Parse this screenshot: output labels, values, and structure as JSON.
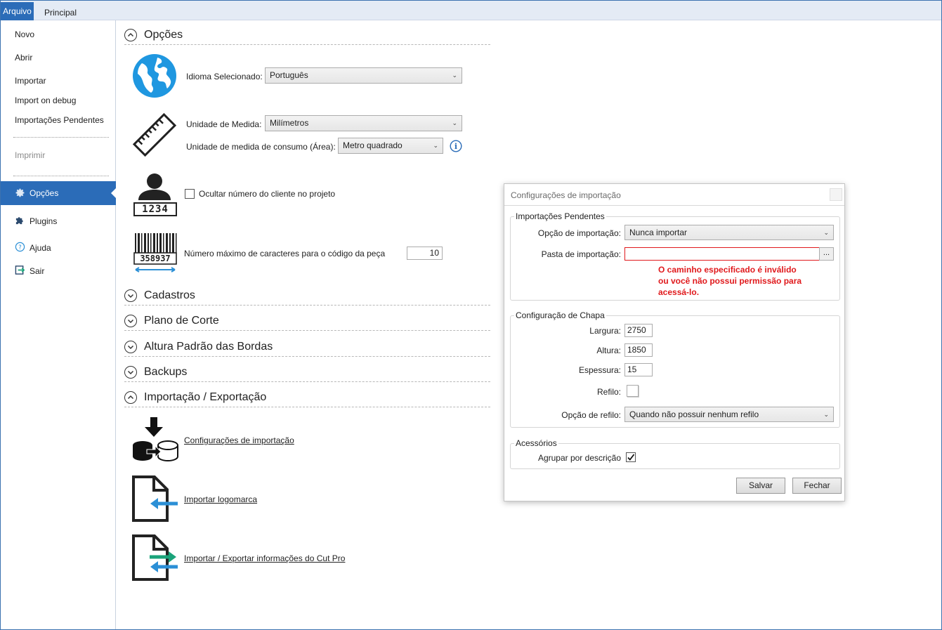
{
  "ribbon": {
    "file_tab": "Arquivo",
    "main_tab": "Principal"
  },
  "sidebar": {
    "novo": "Novo",
    "abrir": "Abrir",
    "importar": "Importar",
    "import_debug": "Import on debug",
    "importacoes_pendentes": "Importações Pendentes",
    "imprimir": "Imprimir",
    "opcoes": "Opções",
    "plugins": "Plugins",
    "ajuda": "Ajuda",
    "sair": "Sair"
  },
  "options": {
    "section_title": "Opções",
    "language_label": "Idioma Selecionado:",
    "language_value": "Português",
    "unit_label": "Unidade de Medida:",
    "unit_value": "Milímetros",
    "consumption_label": "Unidade de medida de consumo (Área):",
    "consumption_value": "Metro quadrado",
    "hide_client_label": "Ocultar número do cliente no projeto",
    "client_icon_number": "1234",
    "max_chars_label": "Número máximo de caracteres para o código da peça",
    "max_chars_value": "10",
    "barcode_number": "358937"
  },
  "sections": {
    "cadastros": "Cadastros",
    "plano_corte": "Plano de Corte",
    "altura_bordas": "Altura Padrão das Bordas",
    "backups": "Backups",
    "import_export": "Importação / Exportação"
  },
  "import_export": {
    "config_import_link": "Configurações de importação",
    "import_logo_link": "Importar logomarca",
    "import_export_cutpro_link": "Importar / Exportar informações do Cut Pro"
  },
  "dialog": {
    "title": "Configurações de importação",
    "pending_group": "Importações Pendentes",
    "import_option_label": "Opção de importação:",
    "import_option_value": "Nunca importar",
    "import_folder_label": "Pasta de importação:",
    "import_folder_value": "",
    "browse_label": "...",
    "error_line1": "O caminho especificado é inválido",
    "error_line2": "ou você não possui permissão para",
    "error_line3": "acessá-lo.",
    "sheet_group": "Configuração de Chapa",
    "largura_label": "Largura:",
    "largura_value": "2750",
    "altura_label": "Altura:",
    "altura_value": "1850",
    "espessura_label": "Espessura:",
    "espessura_value": "15",
    "refilo_label": "Refilo:",
    "refilo_option_label": "Opção de refilo:",
    "refilo_option_value": "Quando não possuir nenhum refilo",
    "accessories_group": "Acessórios",
    "group_by_desc_label": "Agrupar por descrição",
    "save_button": "Salvar",
    "close_button": "Fechar"
  },
  "colors": {
    "accent": "#2b6cb8",
    "globe": "#1f97e0",
    "arrow_blue": "#2b8fd6",
    "arrow_green": "#1aa37a",
    "error": "#e0191c"
  }
}
